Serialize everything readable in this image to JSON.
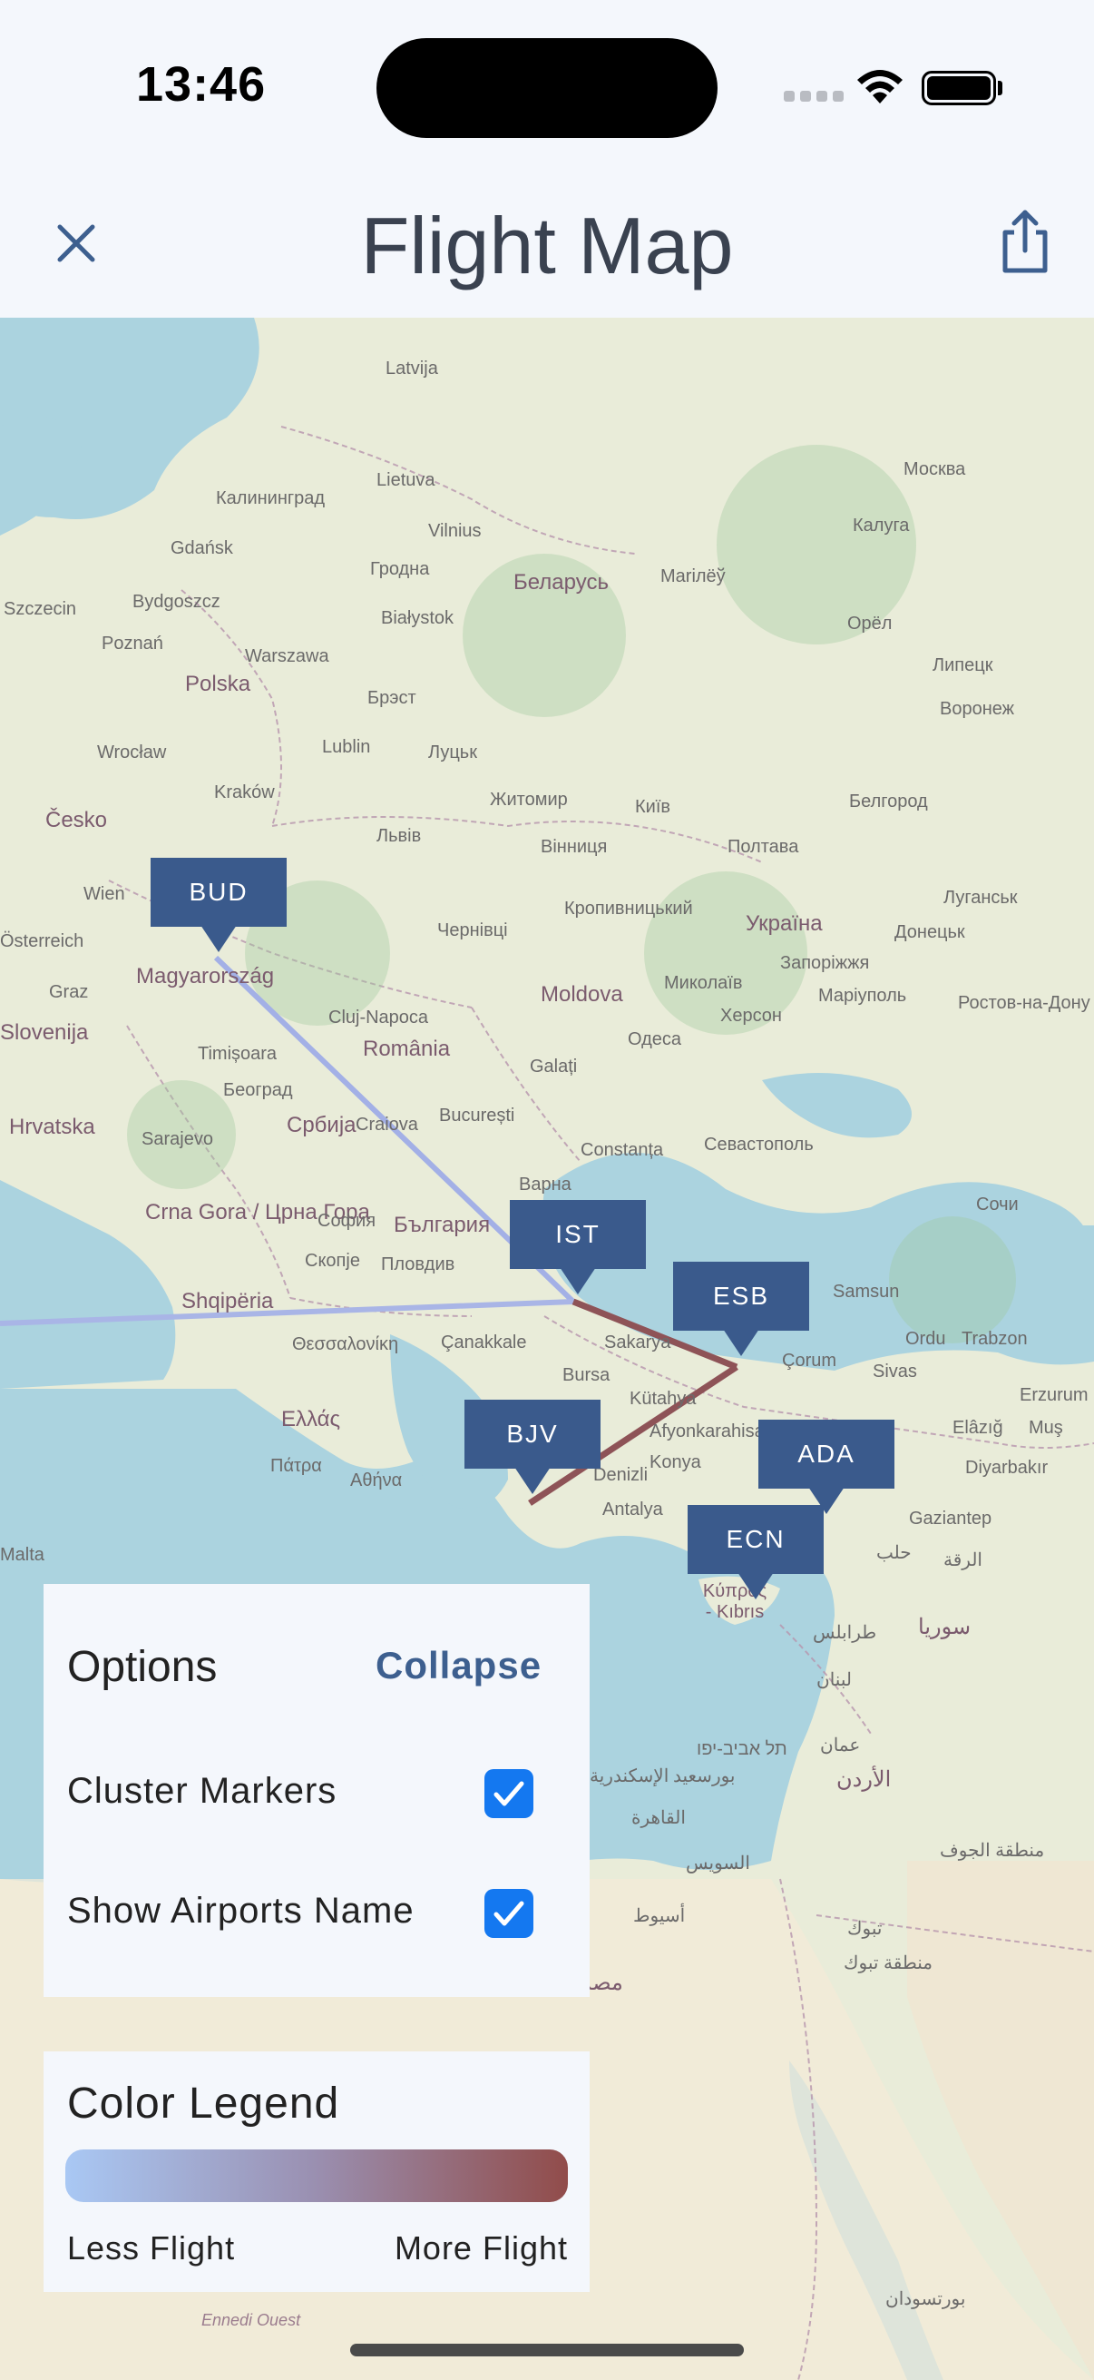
{
  "status_bar": {
    "time": "13:46"
  },
  "header": {
    "title": "Flight Map",
    "close_icon": "close-icon",
    "share_icon": "share-icon"
  },
  "map": {
    "places": [
      {
        "t": "Latvija"
      },
      {
        "t": "Lietuva"
      },
      {
        "t": "Калининград"
      },
      {
        "t": "Vilnius"
      },
      {
        "t": "Gdańsk"
      },
      {
        "t": "Гродна"
      },
      {
        "t": "Беларусь"
      },
      {
        "t": "Mariлёў"
      },
      {
        "t": "Bydgoszcz"
      },
      {
        "t": "Szczecin"
      },
      {
        "t": "Poznań"
      },
      {
        "t": "Białystok"
      },
      {
        "t": "Warszawa"
      },
      {
        "t": "Polska"
      },
      {
        "t": "Брэст"
      },
      {
        "t": "Москва"
      },
      {
        "t": "Калуга"
      },
      {
        "t": "Орёл"
      },
      {
        "t": "Липецк"
      },
      {
        "t": "Воронеж"
      },
      {
        "t": "Wrocław"
      },
      {
        "t": "Lublin"
      },
      {
        "t": "Луцьк"
      },
      {
        "t": "Житомир"
      },
      {
        "t": "Київ"
      },
      {
        "t": "Kraków"
      },
      {
        "t": "Česko"
      },
      {
        "t": "Львів"
      },
      {
        "t": "Вінниця"
      },
      {
        "t": "Полтава"
      },
      {
        "t": "Белгород"
      },
      {
        "t": "Wien"
      },
      {
        "t": "Чернівці"
      },
      {
        "t": "Кропивницький"
      },
      {
        "t": "Україна"
      },
      {
        "t": "Луганськ"
      },
      {
        "t": "Донецьк"
      },
      {
        "t": "Запоріжжя"
      },
      {
        "t": "Маріуполь"
      },
      {
        "t": "Österreich"
      },
      {
        "t": "Magyarország"
      },
      {
        "t": "Moldova"
      },
      {
        "t": "Миколаїв"
      },
      {
        "t": "Херсон"
      },
      {
        "t": "Cluj-Napoca"
      },
      {
        "t": "România"
      },
      {
        "t": "Graz"
      },
      {
        "t": "Slovenija"
      },
      {
        "t": "Одеса"
      },
      {
        "t": "Ростов-на-Дону"
      },
      {
        "t": "Timișoara"
      },
      {
        "t": "Galați"
      },
      {
        "t": "Hrvatska"
      },
      {
        "t": "Београд"
      },
      {
        "t": "Србија"
      },
      {
        "t": "Sarajevo"
      },
      {
        "t": "Craiova"
      },
      {
        "t": "București"
      },
      {
        "t": "Constanța"
      },
      {
        "t": "Севастополь"
      },
      {
        "t": "Варна"
      },
      {
        "t": "Сочи"
      },
      {
        "t": "Crna Gora / Црна Гора"
      },
      {
        "t": "София"
      },
      {
        "t": "България"
      },
      {
        "t": "Скопје"
      },
      {
        "t": "Пловдив"
      },
      {
        "t": "Shqipëria"
      },
      {
        "t": "Samsun"
      },
      {
        "t": "Θεσσαλονίκη"
      },
      {
        "t": "Çanakkale"
      },
      {
        "t": "Sakarya"
      },
      {
        "t": "Ordu"
      },
      {
        "t": "Trabzon"
      },
      {
        "t": "Bursa"
      },
      {
        "t": "Çorum"
      },
      {
        "t": "Sivas"
      },
      {
        "t": "Erzurum"
      },
      {
        "t": "Ελλάς"
      },
      {
        "t": "Kütahya"
      },
      {
        "t": "Afyonkarahisar"
      },
      {
        "t": "Elâzığ"
      },
      {
        "t": "Muş"
      },
      {
        "t": "Πάτρα"
      },
      {
        "t": "Αθήνα"
      },
      {
        "t": "Denizli"
      },
      {
        "t": "Konya"
      },
      {
        "t": "Diyarbakır"
      },
      {
        "t": "Antalya"
      },
      {
        "t": "Gaziantep"
      },
      {
        "t": "Malta"
      },
      {
        "t": "حلب"
      },
      {
        "t": "الرقة"
      },
      {
        "t": "سوريا"
      },
      {
        "t": "Κύπρος - Kıbrıs"
      },
      {
        "t": "طرابلس"
      },
      {
        "t": "لبنان"
      },
      {
        "t": "תל אביב-יפו"
      },
      {
        "t": "عمان"
      },
      {
        "t": "الأردن"
      },
      {
        "t": "الإسكندرية"
      },
      {
        "t": "بورسعيد"
      },
      {
        "t": "القاهرة"
      },
      {
        "t": "السويس"
      },
      {
        "t": "أسيوط"
      },
      {
        "t": "تبوك"
      },
      {
        "t": "منطقة تبوك"
      },
      {
        "t": "منطقة الجوف"
      },
      {
        "t": "Ennedi Ouest"
      },
      {
        "t": "بورتسودان"
      },
      {
        "t": "مصر"
      }
    ],
    "markers": [
      {
        "code": "BUD"
      },
      {
        "code": "IST"
      },
      {
        "code": "ESB"
      },
      {
        "code": "BJV"
      },
      {
        "code": "ADA"
      },
      {
        "code": "ECN"
      }
    ],
    "route_colors": {
      "low": "#a9b5e6",
      "mid": "#9b8aa8",
      "high": "#8e5357"
    }
  },
  "options": {
    "title": "Options",
    "collapse_label": "Collapse",
    "cluster_markers": {
      "label": "Cluster Markers",
      "checked": true
    },
    "show_airports_name": {
      "label": "Show Airports Name",
      "checked": true
    }
  },
  "legend": {
    "title": "Color Legend",
    "less_label": "Less Flight",
    "more_label": "More Flight",
    "gradient_from": "#a9c8f4",
    "gradient_to": "#914c4a"
  }
}
